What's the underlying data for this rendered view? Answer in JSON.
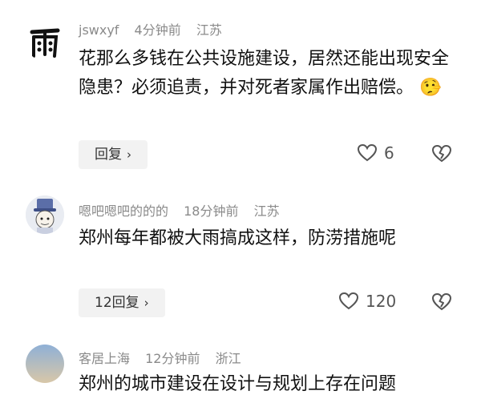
{
  "comments": [
    {
      "username": "jswxyf",
      "time": "4分钟前",
      "location": "江苏",
      "text": "花那么多钱在公共设施建设，居然还能出现安全隐患？必须追责，并对死者家属作出赔偿。",
      "emoji": "🤥",
      "reply_label": "回复",
      "likes": "6",
      "avatar_char": "雨"
    },
    {
      "username": "嗯吧嗯吧的的的",
      "time": "18分钟前",
      "location": "江苏",
      "text": "郑州每年都被大雨搞成这样，防涝措施呢",
      "reply_label": "12回复",
      "likes": "120"
    },
    {
      "username": "客居上海",
      "time": "12分钟前",
      "location": "浙江",
      "text": "郑州的城市建设在设计与规划上存在问题"
    }
  ],
  "icons": {
    "like": "heart-outline-icon",
    "dislike": "broken-heart-icon",
    "chevron": "chevron-right-icon"
  }
}
